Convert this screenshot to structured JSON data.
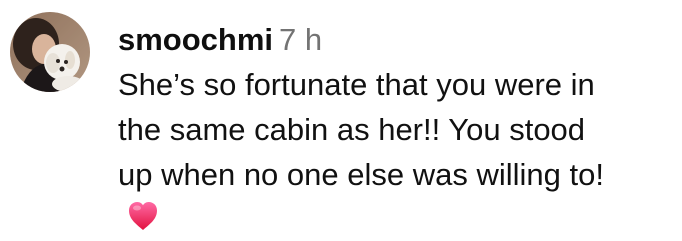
{
  "comment": {
    "avatar_icon": "profile-photo-person-with-white-dog",
    "username": "smoochmi",
    "time": "7 h",
    "text": "She’s so fortunate that you were in\nthe same cabin as her!! You stood\nup when no one else was willing to!",
    "reaction_icon": "heart-emoji-icon",
    "heart_color_top": "#ff6aa5",
    "heart_color_bottom": "#e3123f"
  }
}
